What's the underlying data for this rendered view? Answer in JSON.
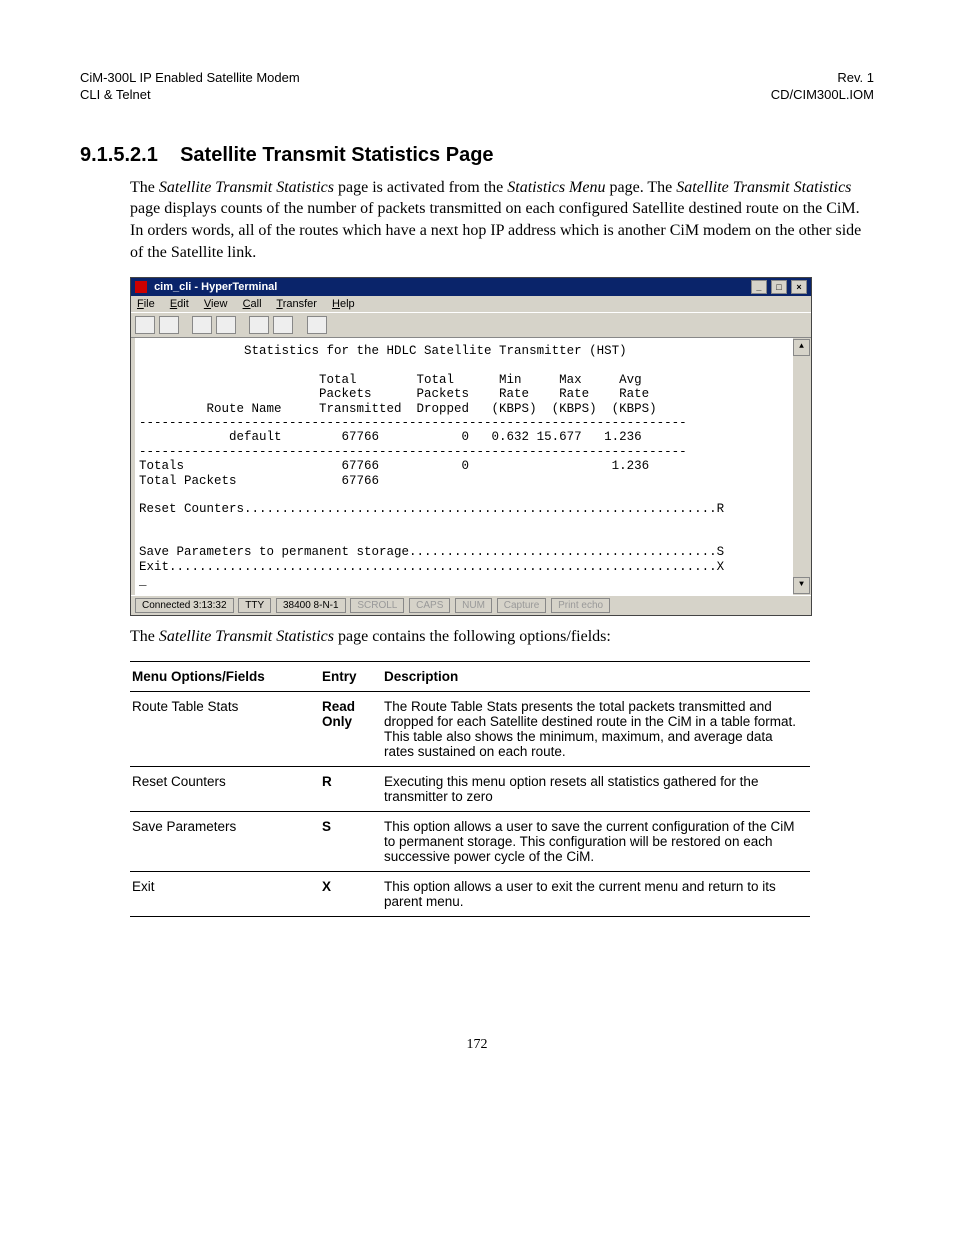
{
  "header": {
    "left1": "CiM-300L IP Enabled Satellite Modem",
    "left2": "CLI & Telnet",
    "right1": "Rev. 1",
    "right2": "CD/CIM300L.IOM"
  },
  "section": {
    "number": "9.1.5.2.1",
    "title": "Satellite Transmit Statistics Page"
  },
  "para1_a": "The ",
  "para1_b": "Satellite Transmit Statistics",
  "para1_c": " page is activated from the ",
  "para1_d": "Statistics Menu",
  "para1_e": " page. The ",
  "para1_f": "Satellite Transmit Statistics",
  "para1_g": " page displays counts of the number of packets transmitted on each configured Satellite destined route on the CiM. In orders words, all of the routes which have a next hop IP address which is another CiM modem on the other side of the Satellite link.",
  "hyperterminal": {
    "title": "cim_cli - HyperTerminal",
    "menus": [
      "File",
      "Edit",
      "View",
      "Call",
      "Transfer",
      "Help"
    ],
    "status": {
      "conn": "Connected 3:13:32",
      "emul": "TTY",
      "line": "38400 8-N-1",
      "dim": [
        "SCROLL",
        "CAPS",
        "NUM",
        "Capture",
        "Print echo"
      ]
    },
    "body": "              Statistics for the HDLC Satellite Transmitter (HST)\n\n                        Total        Total      Min     Max     Avg\n                        Packets      Packets    Rate    Rate    Rate\n         Route Name     Transmitted  Dropped   (KBPS)  (KBPS)  (KBPS)\n-------------------------------------------------------------------------\n            default        67766           0   0.632 15.677   1.236\n-------------------------------------------------------------------------\nTotals                     67766           0                   1.236\nTotal Packets              67766\n\nReset Counters...............................................................R\n\n\nSave Parameters to permanent storage.........................................S\nExit.........................................................................X\n_"
  },
  "para2_a": "The ",
  "para2_b": "Satellite Transmit Statistics",
  "para2_c": " page contains the following options/fields:",
  "table": {
    "headers": [
      "Menu Options/Fields",
      "Entry",
      "Description"
    ],
    "rows": [
      {
        "opt": "Route Table Stats",
        "entry": "Read Only",
        "desc": "The Route Table Stats presents the total packets transmitted and dropped for each Satellite destined route in the CiM in a table format. This table also shows the minimum, maximum, and average data rates sustained on each route."
      },
      {
        "opt": "Reset Counters",
        "entry": "R",
        "desc": "Executing this menu option resets all statistics gathered for the transmitter to zero"
      },
      {
        "opt": "Save Parameters",
        "entry": "S",
        "desc": "This option allows a user to save the current configuration of the CiM to permanent storage. This configuration will be restored on each successive power cycle of the CiM."
      },
      {
        "opt": "Exit",
        "entry": "X",
        "desc": "This option allows a user to exit the current menu and return to its parent menu."
      }
    ]
  },
  "page_num": "172",
  "chart_data": {
    "type": "table",
    "title": "Statistics for the HDLC Satellite Transmitter (HST)",
    "columns": [
      "Route Name",
      "Total Packets Transmitted",
      "Total Packets Dropped",
      "Min Rate (KBPS)",
      "Max Rate (KBPS)",
      "Avg Rate (KBPS)"
    ],
    "rows": [
      [
        "default",
        67766,
        0,
        0.632,
        15.677,
        1.236
      ]
    ],
    "totals": {
      "Total Packets Transmitted": 67766,
      "Total Packets Dropped": 0,
      "Avg Rate (KBPS)": 1.236,
      "Total Packets": 67766
    }
  }
}
